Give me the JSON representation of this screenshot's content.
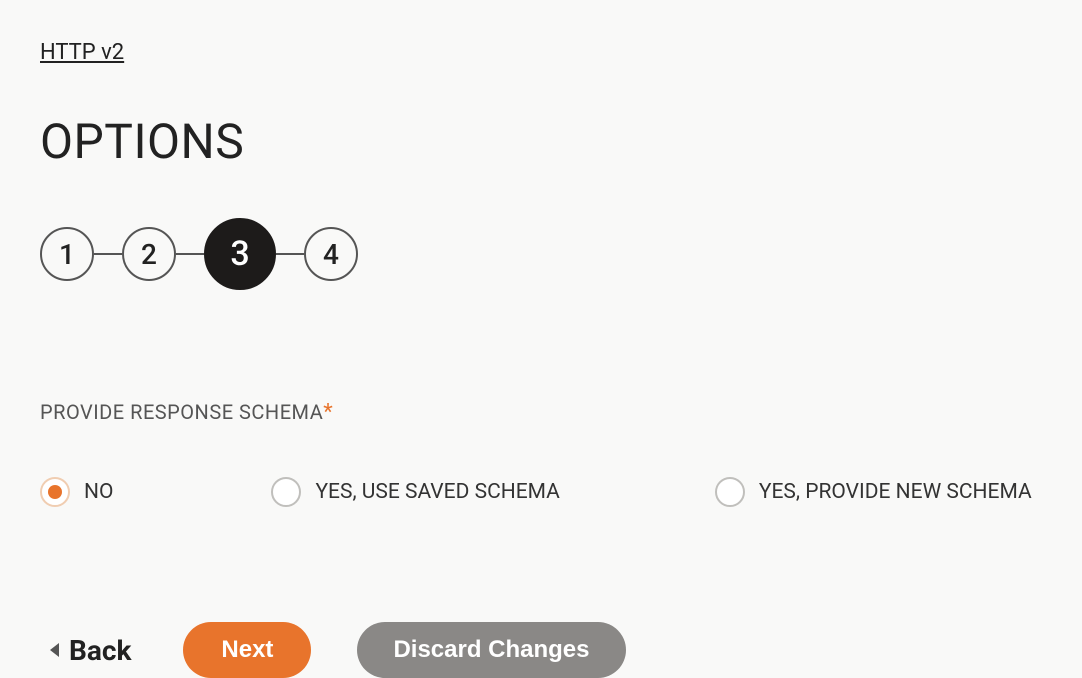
{
  "breadcrumb": {
    "label": "HTTP v2"
  },
  "page": {
    "title": "OPTIONS"
  },
  "stepper": {
    "steps": [
      "1",
      "2",
      "3",
      "4"
    ],
    "active_index": 2
  },
  "field": {
    "label": "PROVIDE RESPONSE SCHEMA",
    "required_marker": "*",
    "options": [
      {
        "label": "NO",
        "selected": true
      },
      {
        "label": "YES, USE SAVED SCHEMA",
        "selected": false
      },
      {
        "label": "YES, PROVIDE NEW SCHEMA",
        "selected": false
      }
    ]
  },
  "buttons": {
    "back": "Back",
    "next": "Next",
    "discard": "Discard Changes"
  }
}
